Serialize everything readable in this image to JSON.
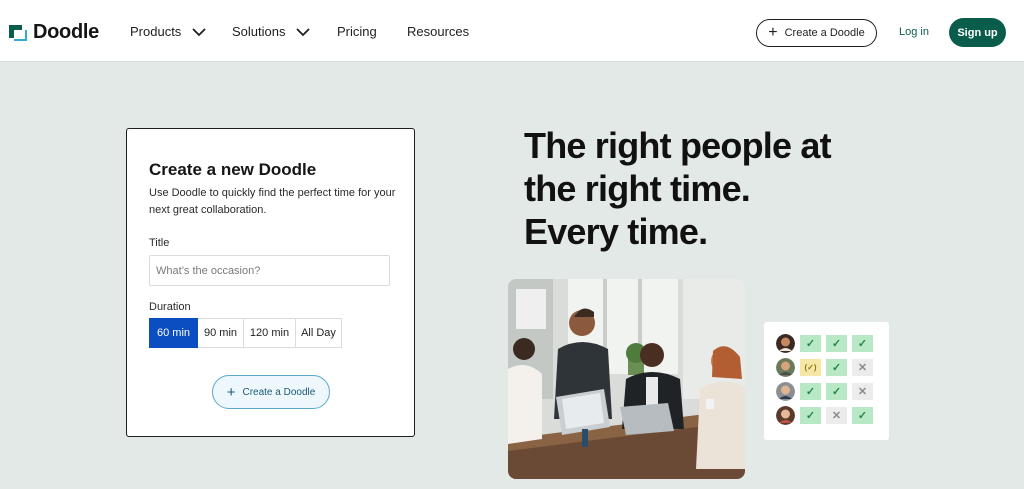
{
  "nav": {
    "brand": "Doodle",
    "items": [
      {
        "label": "Products",
        "has_dropdown": true
      },
      {
        "label": "Solutions",
        "has_dropdown": true
      },
      {
        "label": "Pricing",
        "has_dropdown": false
      },
      {
        "label": "Resources",
        "has_dropdown": false
      }
    ],
    "create_label": "Create a Doodle",
    "login_label": "Log in",
    "signup_label": "Sign up"
  },
  "form": {
    "heading": "Create a new Doodle",
    "description": "Use Doodle to quickly find the perfect time for your next great collaboration.",
    "title_label": "Title",
    "title_placeholder": "What’s the occasion?",
    "title_value": "",
    "duration_label": "Duration",
    "durations": [
      "60 min",
      "90 min",
      "120 min",
      "All Day"
    ],
    "selected_duration": "60 min",
    "create_label": "Create a Doodle"
  },
  "hero": {
    "line1": "The right people at",
    "line2": "the right time.",
    "line3": "Every time."
  },
  "availability": {
    "rows": [
      [
        "yes",
        "yes",
        "yes"
      ],
      [
        "maybe",
        "yes",
        "no"
      ],
      [
        "yes",
        "yes",
        "no"
      ],
      [
        "yes",
        "no",
        "yes"
      ]
    ]
  },
  "colors": {
    "brand_green": "#0a5d4a",
    "selected_blue": "#0b4ec1",
    "page_background": "#e3e9e7",
    "yes": "#b9e8c6",
    "maybe": "#f6e7a6",
    "no": "#ececec"
  },
  "icons": {
    "logo": "doodle-logo-icon",
    "dropdown": "chevron-down-icon",
    "create": "plus-icon",
    "yes": "check-icon",
    "maybe": "check-in-parentheses-icon",
    "no": "x-icon"
  }
}
